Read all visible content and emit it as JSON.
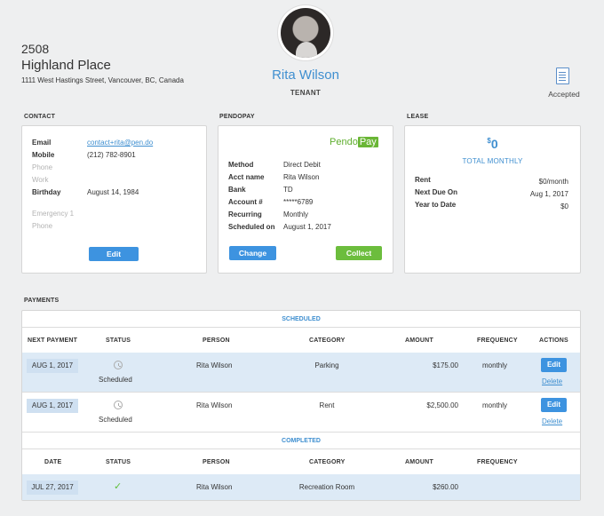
{
  "header": {
    "unit_number": "2508",
    "street_name": "Highland Place",
    "address": "1111 West Hastings Street, Vancouver, BC, Canada",
    "tenant_name": "Rita Wilson",
    "tenant_role": "TENANT",
    "document_status": "Accepted",
    "document_icon": "document-icon"
  },
  "contact": {
    "section_label": "CONTACT",
    "rows": [
      {
        "label": "Email",
        "value": "contact+rita@pen.do"
      },
      {
        "label": "Mobile",
        "value": "(212) 782-8901"
      },
      {
        "label": "Phone",
        "value": ""
      },
      {
        "label": "Work",
        "value": ""
      },
      {
        "label": "Birthday",
        "value": "August 14, 1984"
      }
    ],
    "emergency_label": "Emergency 1",
    "emergency_phone_label": "Phone",
    "edit_label": "Edit"
  },
  "pendopay": {
    "section_label": "PENDOPAY",
    "logo_pendo": "Pendo",
    "logo_pay": "Pay",
    "rows": [
      {
        "label": "Method",
        "value": "Direct Debit"
      },
      {
        "label": "Acct name",
        "value": "Rita Wilson"
      },
      {
        "label": "Bank",
        "value": "TD"
      },
      {
        "label": "Account #",
        "value": "*****6789"
      },
      {
        "label": "Recurring",
        "value": "Monthly"
      },
      {
        "label": "Scheduled on",
        "value": "August 1, 2017"
      }
    ],
    "change_label": "Change",
    "collect_label": "Collect"
  },
  "lease": {
    "section_label": "LEASE",
    "currency": "$",
    "amount": "0",
    "total_label": "TOTAL MONTHLY",
    "rows": [
      {
        "label": "Rent",
        "value": "$0/month"
      },
      {
        "label": "Next Due On",
        "value": "Aug 1, 2017"
      },
      {
        "label": "Year to Date",
        "value": "$0"
      }
    ]
  },
  "payments": {
    "section_label": "PAYMENTS",
    "scheduled_title": "SCHEDULED",
    "scheduled_headers": [
      "NEXT PAYMENT",
      "STATUS",
      "PERSON",
      "CATEGORY",
      "AMOUNT",
      "FREQUENCY",
      "ACTIONS"
    ],
    "scheduled_rows": [
      {
        "date": "AUG 1, 2017",
        "status": "Scheduled",
        "person": "Rita Wilson",
        "category": "Parking",
        "amount": "$175.00",
        "frequency": "monthly",
        "edit": "Edit",
        "delete": "Delete"
      },
      {
        "date": "AUG 1, 2017",
        "status": "Scheduled",
        "person": "Rita Wilson",
        "category": "Rent",
        "amount": "$2,500.00",
        "frequency": "monthly",
        "edit": "Edit",
        "delete": "Delete"
      }
    ],
    "completed_title": "COMPLETED",
    "completed_headers": [
      "DATE",
      "STATUS",
      "PERSON",
      "CATEGORY",
      "AMOUNT",
      "FREQUENCY"
    ],
    "completed_rows": [
      {
        "date": "JUL 27, 2017",
        "status_icon": "check-icon",
        "person": "Rita Wilson",
        "category": "Recreation Room",
        "amount": "$260.00"
      }
    ]
  }
}
